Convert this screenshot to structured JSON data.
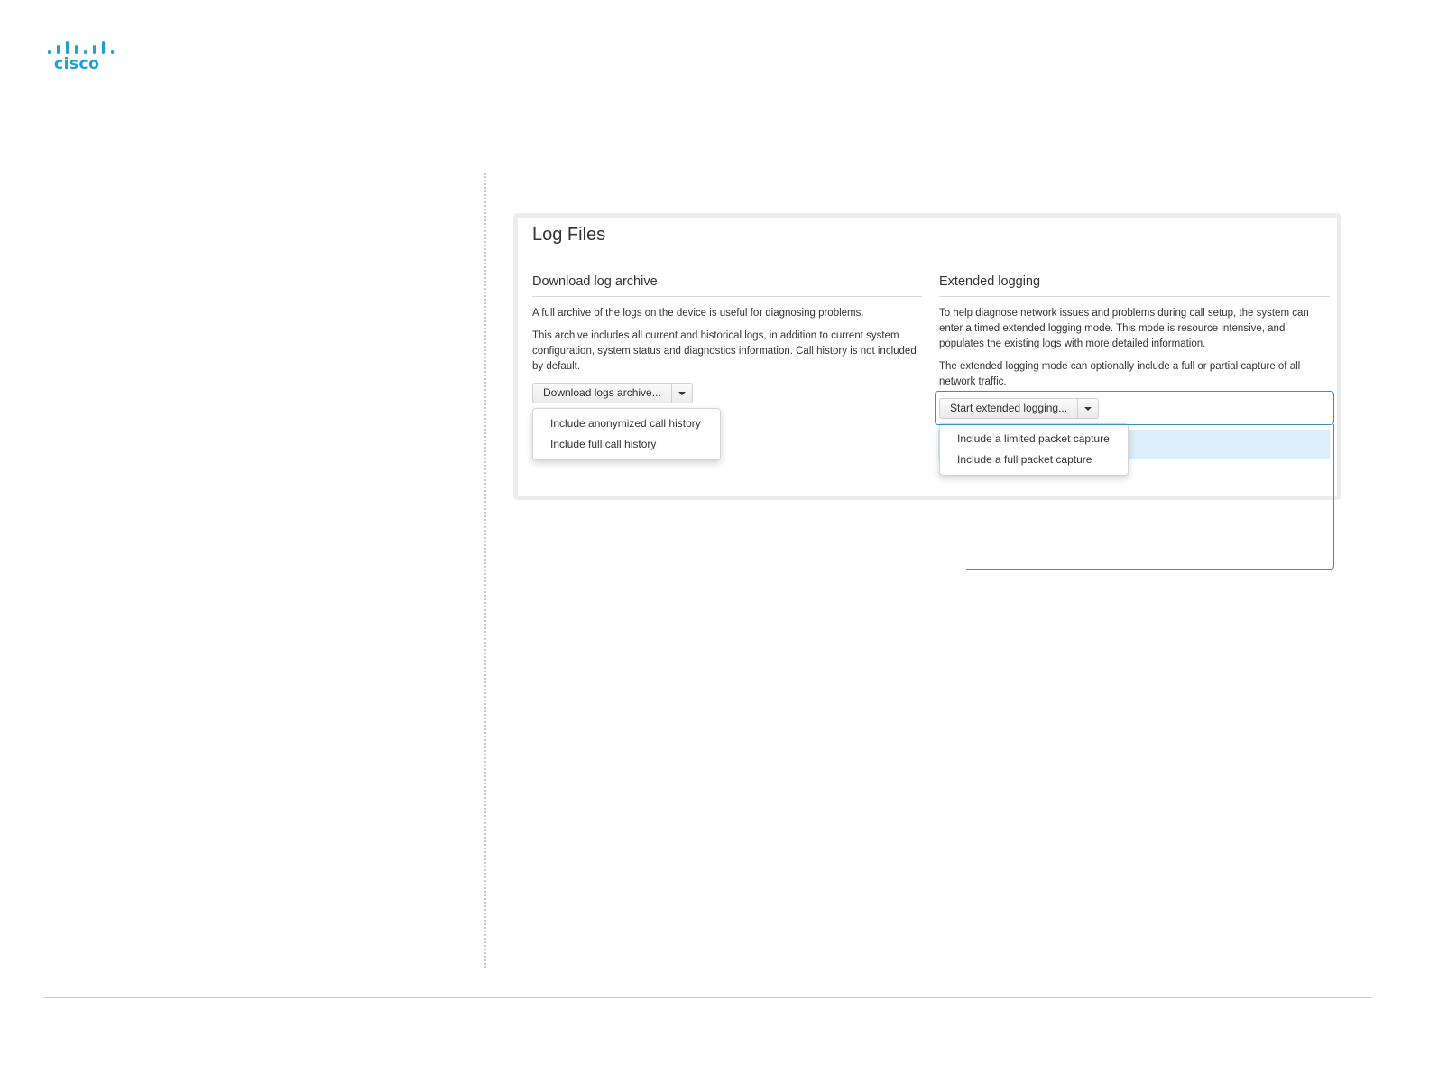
{
  "brand": {
    "name": "cisco",
    "color": "#1ba0d7"
  },
  "panel": {
    "title": "Log Files"
  },
  "download_archive": {
    "heading": "Download log archive",
    "para1": "A full archive of the logs on the device is useful for diagnosing problems.",
    "para2": "This archive includes all current and historical logs, in addition to current system configuration, system status and diagnostics information. Call history is not included by default.",
    "button_label": "Download logs archive...",
    "menu": [
      "Include anonymized call history",
      "Include full call history"
    ]
  },
  "extended_logging": {
    "heading": "Extended logging",
    "para1": "To help diagnose network issues and problems during call setup, the system can enter a timed extended logging mode. This mode is resource intensive, and populates the existing logs with more detailed information.",
    "para2": "The extended logging mode can optionally include a full or partial capture of all network traffic.",
    "button_label": "Start extended logging...",
    "menu": [
      "Include a limited packet capture",
      "Include a full packet capture"
    ]
  },
  "colors": {
    "callout": "#3a8fc6",
    "highlight": "#dceef8"
  },
  "icons": [
    "cisco-logo-icon",
    "chevron-down-icon"
  ]
}
